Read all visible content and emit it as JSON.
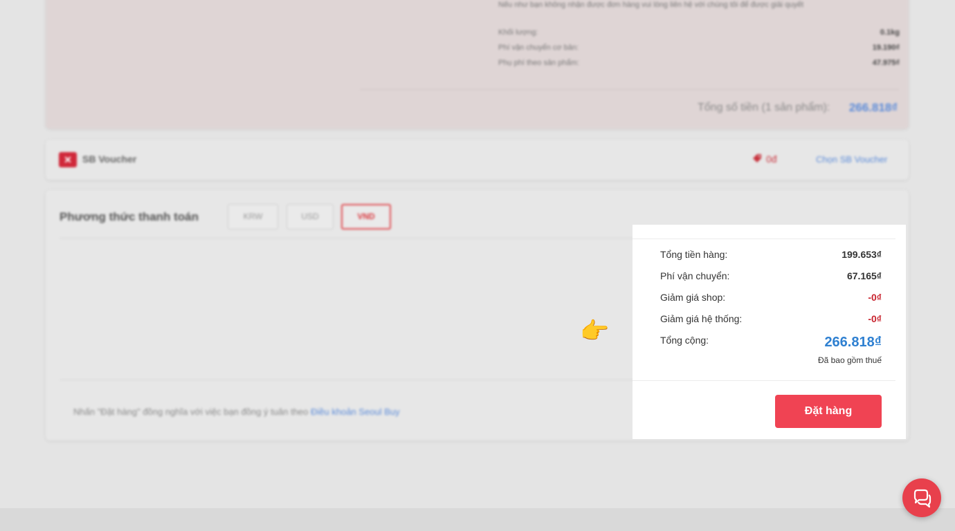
{
  "shop_card": {
    "note": "Nếu như bạn không nhận được đơn hàng vui lòng liên hệ với chúng tôi để được giải quyết",
    "fees": [
      {
        "label": "Khối lượng:",
        "value": "0.1kg"
      },
      {
        "label": "Phí vận chuyển cơ bản:",
        "value": "19.190₫"
      },
      {
        "label": "Phụ phí theo sản phẩm:",
        "value": "47.975₫"
      }
    ],
    "total_label": "Tổng số tiền (1 sản phẩm):",
    "total_value": "266.818₫"
  },
  "voucher": {
    "icon_text": "✕",
    "label": "SB Voucher",
    "amount": "0đ",
    "choose_label": "Chọn SB Voucher"
  },
  "payment": {
    "title": "Phương thức thanh toán",
    "options": [
      "KRW",
      "USD",
      "VND"
    ],
    "selected": "VND",
    "terms_prefix": "Nhấn \"Đặt hàng\" đồng nghĩa với việc bạn đồng ý tuân theo",
    "terms_link": "Điều khoản Seoul Buy"
  },
  "summary": {
    "rows": [
      {
        "label": "Tổng tiền hàng:",
        "value": "199.653₫"
      },
      {
        "label": "Phí vận chuyển:",
        "value": "67.165₫"
      },
      {
        "label": "Giảm giá shop:",
        "value": "-0₫"
      },
      {
        "label": "Giảm giá hệ thống:",
        "value": "-0₫"
      }
    ],
    "total_label": "Tổng cộng:",
    "total_value": "266.818₫",
    "tax_note": "Đã bao gồm thuế",
    "order_button": "Đặt hàng"
  },
  "pointer_glyph": "👉",
  "colors": {
    "accent_red": "#f04353",
    "discount_red": "#c8232e",
    "total_blue": "#2f80d1"
  },
  "icons": [
    "voucher-icon",
    "tag-icon",
    "pointing-hand-icon",
    "chat-icon"
  ]
}
